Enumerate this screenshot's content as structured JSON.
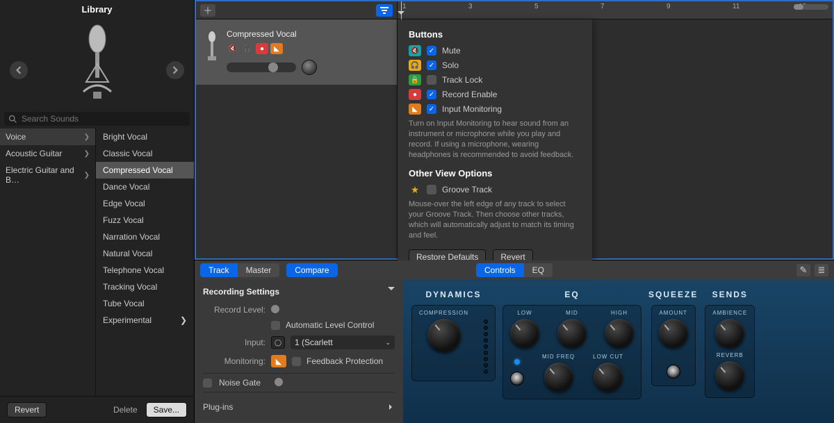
{
  "library": {
    "title": "Library",
    "search_placeholder": "Search Sounds",
    "categories": [
      {
        "label": "Voice",
        "selected": true,
        "has_children": true
      },
      {
        "label": "Acoustic Guitar",
        "selected": false,
        "has_children": true
      },
      {
        "label": "Electric Guitar and B…",
        "selected": false,
        "has_children": true
      }
    ],
    "presets": [
      {
        "label": "Bright Vocal"
      },
      {
        "label": "Classic Vocal"
      },
      {
        "label": "Compressed Vocal",
        "selected": true
      },
      {
        "label": "Dance Vocal"
      },
      {
        "label": "Edge Vocal"
      },
      {
        "label": "Fuzz Vocal"
      },
      {
        "label": "Narration Vocal"
      },
      {
        "label": "Natural Vocal"
      },
      {
        "label": "Telephone Vocal"
      },
      {
        "label": "Tracking Vocal"
      },
      {
        "label": "Tube Vocal"
      },
      {
        "label": "Experimental",
        "has_children": true
      }
    ],
    "footer": {
      "revert": "Revert",
      "delete": "Delete",
      "save": "Save..."
    }
  },
  "track": {
    "name": "Compressed Vocal"
  },
  "timeline": {
    "ticks": [
      "1",
      "3",
      "5",
      "7",
      "9",
      "11",
      "13"
    ]
  },
  "popup": {
    "title_buttons": "Buttons",
    "mute": "Mute",
    "solo": "Solo",
    "track_lock": "Track Lock",
    "record_enable": "Record Enable",
    "input_monitoring": "Input Monitoring",
    "help1": "Turn on Input Monitoring to hear sound from an instrument or microphone while you play and record. If using a microphone, wearing headphones is recommended to avoid feedback.",
    "title_other": "Other View Options",
    "groove_track": "Groove Track",
    "help2": "Mouse-over the left edge of any track to select your Groove Track. Then choose other tracks, which will automatically adjust to match its timing and feel.",
    "restore_defaults": "Restore Defaults",
    "revert": "Revert",
    "checks": {
      "mute": true,
      "solo": true,
      "track_lock": false,
      "record_enable": true,
      "input_monitoring": true,
      "groove_track": false
    }
  },
  "inspector": {
    "tabs_left": [
      {
        "label": "Track",
        "on": true
      },
      {
        "label": "Master",
        "on": false
      }
    ],
    "compare": "Compare",
    "tabs_center": [
      {
        "label": "Controls",
        "on": true
      },
      {
        "label": "EQ",
        "on": false
      }
    ],
    "recording_settings": "Recording Settings",
    "record_level": "Record Level:",
    "auto_level": "Automatic Level Control",
    "input_label": "Input:",
    "input_value": "1  (Scarlett",
    "monitoring_label": "Monitoring:",
    "feedback_protection": "Feedback Protection",
    "noise_gate": "Noise Gate",
    "plugins": "Plug-ins"
  },
  "fx": {
    "dynamics": {
      "title": "DYNAMICS",
      "compression": "COMPRESSION"
    },
    "eq": {
      "title": "EQ",
      "low": "LOW",
      "mid": "MID",
      "high": "HIGH",
      "mid_freq": "MID FREQ",
      "low_cut": "LOW CUT"
    },
    "squeeze": {
      "title": "SQUEEZE",
      "amount": "AMOUNT"
    },
    "sends": {
      "title": "SENDS",
      "ambience": "AMBIENCE",
      "reverb": "REVERB"
    }
  }
}
